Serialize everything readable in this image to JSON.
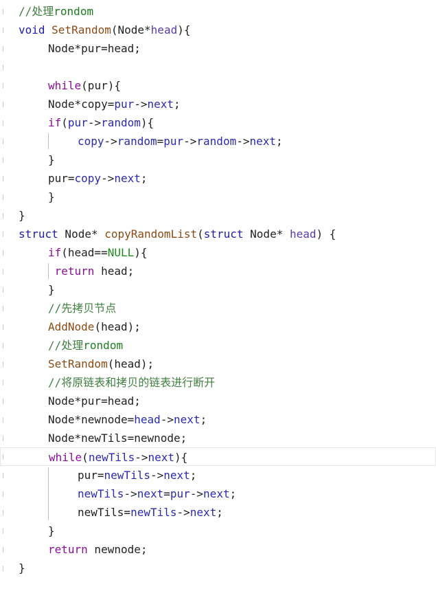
{
  "code_lines": [
    {
      "indent": 0,
      "tokens": [
        {
          "t": "//处理",
          "c": "comment"
        },
        {
          "t": "rondom",
          "c": "comment-kw"
        }
      ]
    },
    {
      "indent": 0,
      "tokens": [
        {
          "t": "void",
          "c": "type-kw"
        },
        {
          "t": " ",
          "c": "op"
        },
        {
          "t": "SetRandom",
          "c": "func"
        },
        {
          "t": "(Node*",
          "c": "op"
        },
        {
          "t": "head",
          "c": "param"
        },
        {
          "t": "){",
          "c": "op"
        }
      ]
    },
    {
      "indent": 1,
      "tokens": [
        {
          "t": "Node*pur=head;",
          "c": "var"
        }
      ]
    },
    {
      "indent": 1,
      "tokens": []
    },
    {
      "indent": 1,
      "tokens": [
        {
          "t": "while",
          "c": "keyword"
        },
        {
          "t": "(pur){",
          "c": "op"
        }
      ]
    },
    {
      "indent": 1,
      "tokens": [
        {
          "t": "Node*copy=",
          "c": "var"
        },
        {
          "t": "pur",
          "c": "field"
        },
        {
          "t": "->",
          "c": "op"
        },
        {
          "t": "next",
          "c": "field"
        },
        {
          "t": ";",
          "c": "op"
        }
      ]
    },
    {
      "indent": 1,
      "tokens": [
        {
          "t": "if",
          "c": "keyword"
        },
        {
          "t": "(",
          "c": "op"
        },
        {
          "t": "pur",
          "c": "field"
        },
        {
          "t": "->",
          "c": "op"
        },
        {
          "t": "random",
          "c": "field"
        },
        {
          "t": "){",
          "c": "op"
        }
      ]
    },
    {
      "indent": 2,
      "tokens": [
        {
          "t": "copy",
          "c": "field"
        },
        {
          "t": "->",
          "c": "op"
        },
        {
          "t": "random",
          "c": "field"
        },
        {
          "t": "=",
          "c": "op"
        },
        {
          "t": "pur",
          "c": "field"
        },
        {
          "t": "->",
          "c": "op"
        },
        {
          "t": "random",
          "c": "field"
        },
        {
          "t": "->",
          "c": "op"
        },
        {
          "t": "next",
          "c": "field"
        },
        {
          "t": ";",
          "c": "op"
        }
      ]
    },
    {
      "indent": 1,
      "tokens": [
        {
          "t": "}",
          "c": "op"
        }
      ]
    },
    {
      "indent": 1,
      "tokens": [
        {
          "t": "pur=",
          "c": "var"
        },
        {
          "t": "copy",
          "c": "field"
        },
        {
          "t": "->",
          "c": "op"
        },
        {
          "t": "next",
          "c": "field"
        },
        {
          "t": ";",
          "c": "op"
        }
      ]
    },
    {
      "indent": 1,
      "tokens": [
        {
          "t": "}",
          "c": "op"
        }
      ]
    },
    {
      "indent": 0,
      "tokens": [
        {
          "t": "}",
          "c": "op"
        }
      ]
    },
    {
      "indent": 0,
      "tokens": [
        {
          "t": "struct",
          "c": "type-kw"
        },
        {
          "t": " Node* ",
          "c": "op"
        },
        {
          "t": "copyRandomList",
          "c": "func"
        },
        {
          "t": "(",
          "c": "op"
        },
        {
          "t": "struct",
          "c": "type-kw"
        },
        {
          "t": " Node* ",
          "c": "op"
        },
        {
          "t": "head",
          "c": "param"
        },
        {
          "t": ") {",
          "c": "op"
        }
      ]
    },
    {
      "indent": 1,
      "tokens": [
        {
          "t": "if",
          "c": "keyword"
        },
        {
          "t": "(head==",
          "c": "op"
        },
        {
          "t": "NULL",
          "c": "macro"
        },
        {
          "t": "){",
          "c": "op"
        }
      ]
    },
    {
      "indent": 1,
      "tokens": [
        {
          "t": " ",
          "c": "op"
        },
        {
          "t": "return",
          "c": "keyword"
        },
        {
          "t": " head;",
          "c": "op"
        }
      ]
    },
    {
      "indent": 1,
      "tokens": [
        {
          "t": "}",
          "c": "op"
        }
      ]
    },
    {
      "indent": 1,
      "tokens": [
        {
          "t": "//先拷贝节点",
          "c": "comment"
        }
      ]
    },
    {
      "indent": 1,
      "tokens": [
        {
          "t": "AddNode",
          "c": "func"
        },
        {
          "t": "(head);",
          "c": "op"
        }
      ]
    },
    {
      "indent": 1,
      "tokens": [
        {
          "t": "//处理",
          "c": "comment"
        },
        {
          "t": "rondom",
          "c": "comment-kw"
        }
      ]
    },
    {
      "indent": 1,
      "tokens": [
        {
          "t": "SetRandom",
          "c": "func"
        },
        {
          "t": "(head);",
          "c": "op"
        }
      ]
    },
    {
      "indent": 1,
      "tokens": [
        {
          "t": "//将原链表和拷贝的链表进行断开",
          "c": "comment"
        }
      ]
    },
    {
      "indent": 1,
      "tokens": [
        {
          "t": "Node*pur=head;",
          "c": "var"
        }
      ]
    },
    {
      "indent": 1,
      "tokens": [
        {
          "t": "Node*newnode=",
          "c": "var"
        },
        {
          "t": "head",
          "c": "field"
        },
        {
          "t": "->",
          "c": "op"
        },
        {
          "t": "next",
          "c": "field"
        },
        {
          "t": ";",
          "c": "op"
        }
      ]
    },
    {
      "indent": 1,
      "tokens": [
        {
          "t": "Node*newTils=newnode;",
          "c": "var"
        }
      ]
    },
    {
      "indent": 1,
      "tokens": [
        {
          "t": "while",
          "c": "keyword"
        },
        {
          "t": "(",
          "c": "op"
        },
        {
          "t": "newTils",
          "c": "field"
        },
        {
          "t": "->",
          "c": "op"
        },
        {
          "t": "next",
          "c": "field"
        },
        {
          "t": "){",
          "c": "op"
        }
      ],
      "current": true
    },
    {
      "indent": 2,
      "tokens": [
        {
          "t": "pur=",
          "c": "var"
        },
        {
          "t": "newTils",
          "c": "field"
        },
        {
          "t": "->",
          "c": "op"
        },
        {
          "t": "next",
          "c": "field"
        },
        {
          "t": ";",
          "c": "op"
        }
      ]
    },
    {
      "indent": 2,
      "tokens": [
        {
          "t": "newTils",
          "c": "field"
        },
        {
          "t": "->",
          "c": "op"
        },
        {
          "t": "next",
          "c": "field"
        },
        {
          "t": "=",
          "c": "op"
        },
        {
          "t": "pur",
          "c": "field"
        },
        {
          "t": "->",
          "c": "op"
        },
        {
          "t": "next",
          "c": "field"
        },
        {
          "t": ";",
          "c": "op"
        }
      ]
    },
    {
      "indent": 2,
      "tokens": [
        {
          "t": "newTils=",
          "c": "var"
        },
        {
          "t": "newTils",
          "c": "field"
        },
        {
          "t": "->",
          "c": "op"
        },
        {
          "t": "next",
          "c": "field"
        },
        {
          "t": ";",
          "c": "op"
        }
      ]
    },
    {
      "indent": 1,
      "tokens": [
        {
          "t": "}",
          "c": "op"
        }
      ]
    },
    {
      "indent": 1,
      "tokens": [
        {
          "t": "return",
          "c": "keyword"
        },
        {
          "t": " newnode;",
          "c": "op"
        }
      ]
    },
    {
      "indent": 0,
      "tokens": [
        {
          "t": "}",
          "c": "op"
        }
      ]
    }
  ],
  "colors": {
    "comment": "#3f7f3f",
    "keyword": "#8a0f96",
    "type_keyword": "#1c1ca8",
    "function": "#8a4a14",
    "field": "#2a2ab0",
    "macro": "#1d8a1d",
    "current_line_border": "#e8e8e8"
  }
}
